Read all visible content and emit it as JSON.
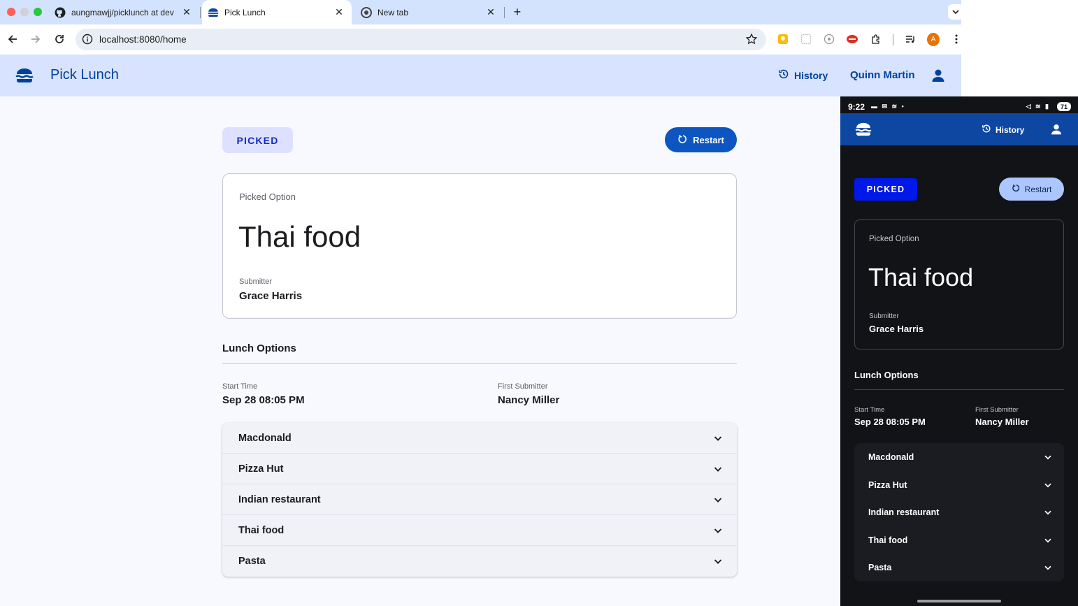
{
  "browser": {
    "tabs": [
      {
        "title": "aungmawjj/picklunch at dev",
        "icon": "github-icon"
      },
      {
        "title": "Pick Lunch",
        "icon": "burger-icon",
        "active": true
      },
      {
        "title": "New tab",
        "icon": "chrome-icon"
      }
    ],
    "url": "localhost:8080/home",
    "profile_initial": "A"
  },
  "app": {
    "title": "Pick Lunch",
    "history_label": "History",
    "user_name": "Quinn Martin"
  },
  "main": {
    "status": "PICKED",
    "restart_label": "Restart",
    "picked_label": "Picked Option",
    "picked_value": "Thai food",
    "submitter_label": "Submitter",
    "submitter_value": "Grace Harris",
    "section_title": "Lunch Options",
    "start_time_label": "Start Time",
    "start_time_value": "Sep 28 08:05 PM",
    "first_submitter_label": "First Submitter",
    "first_submitter_value": "Nancy Miller",
    "options": [
      "Macdonald",
      "Pizza Hut",
      "Indian restaurant",
      "Thai food",
      "Pasta"
    ]
  },
  "phone": {
    "time": "9:22",
    "battery": "71",
    "history_label": "History"
  },
  "colors": {
    "chrome_bg": "#d3e3fd",
    "header_bg": "#d7e3ff",
    "primary": "#0d56c1",
    "phone_appbar": "#0d47a1",
    "phone_chip": "#0018e8"
  }
}
